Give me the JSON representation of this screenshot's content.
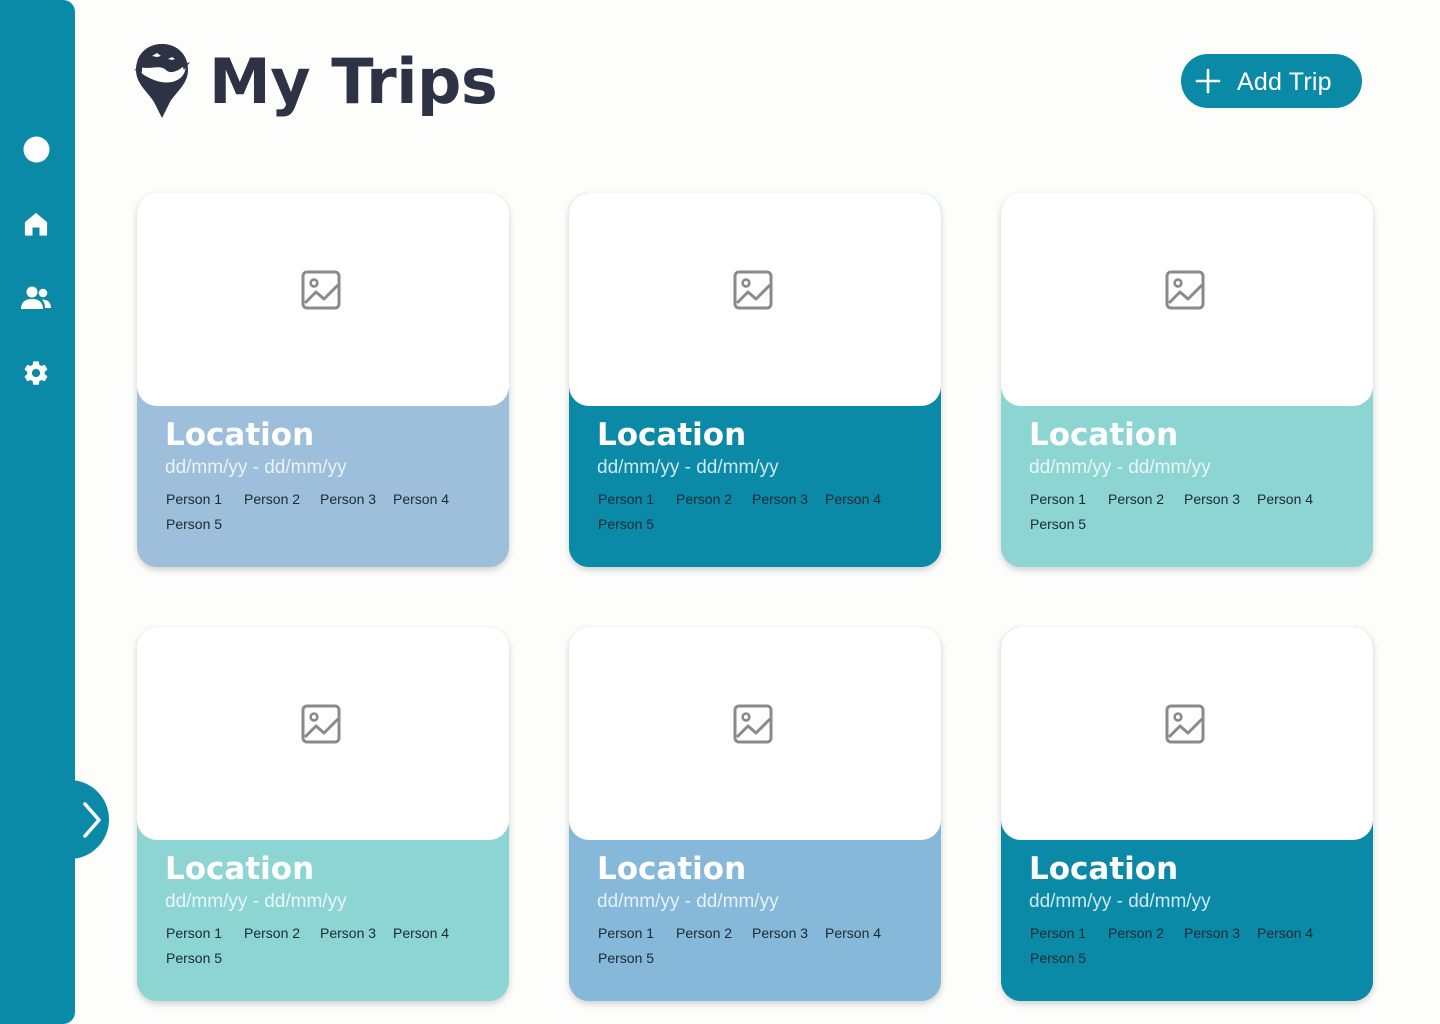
{
  "header": {
    "title": "My Trips",
    "logo_icon": "map-pin-travel-logo"
  },
  "actions": {
    "add_trip_label": "Add Trip",
    "add_trip_icon": "plus-icon"
  },
  "sidebar": {
    "items": [
      {
        "name": "profile",
        "icon": "circle-icon"
      },
      {
        "name": "home",
        "icon": "home-icon"
      },
      {
        "name": "friends",
        "icon": "users-icon"
      },
      {
        "name": "settings",
        "icon": "gear-icon"
      }
    ],
    "expand_icon": "chevron-right-icon"
  },
  "colors": {
    "primary": "#0b8aa8",
    "background": "#fdfdfb",
    "title_text": "#2d3344",
    "card_blue_light": "#9dbfdb",
    "card_blue_mid": "#85b8d9",
    "card_teal_light": "#8dd5d3",
    "card_teal_dark": "#0b8aa8"
  },
  "trips": [
    {
      "location": "Location",
      "dates": "dd/mm/yy - dd/mm/yy",
      "people": [
        "Person 1",
        "Person 2",
        "Person 3",
        "Person 4",
        "Person 5"
      ],
      "color": "#9dbfdb"
    },
    {
      "location": "Location",
      "dates": "dd/mm/yy - dd/mm/yy",
      "people": [
        "Person 1",
        "Person 2",
        "Person 3",
        "Person 4",
        "Person 5"
      ],
      "color": "#0b8aa8"
    },
    {
      "location": "Location",
      "dates": "dd/mm/yy - dd/mm/yy",
      "people": [
        "Person 1",
        "Person 2",
        "Person 3",
        "Person 4",
        "Person 5"
      ],
      "color": "#8dd5d3"
    },
    {
      "location": "Location",
      "dates": "dd/mm/yy - dd/mm/yy",
      "people": [
        "Person 1",
        "Person 2",
        "Person 3",
        "Person 4",
        "Person 5"
      ],
      "color": "#8dd5d3"
    },
    {
      "location": "Location",
      "dates": "dd/mm/yy - dd/mm/yy",
      "people": [
        "Person 1",
        "Person 2",
        "Person 3",
        "Person 4",
        "Person 5"
      ],
      "color": "#85b8d9"
    },
    {
      "location": "Location",
      "dates": "dd/mm/yy - dd/mm/yy",
      "people": [
        "Person 1",
        "Person 2",
        "Person 3",
        "Person 4",
        "Person 5"
      ],
      "color": "#0b8aa8"
    }
  ]
}
